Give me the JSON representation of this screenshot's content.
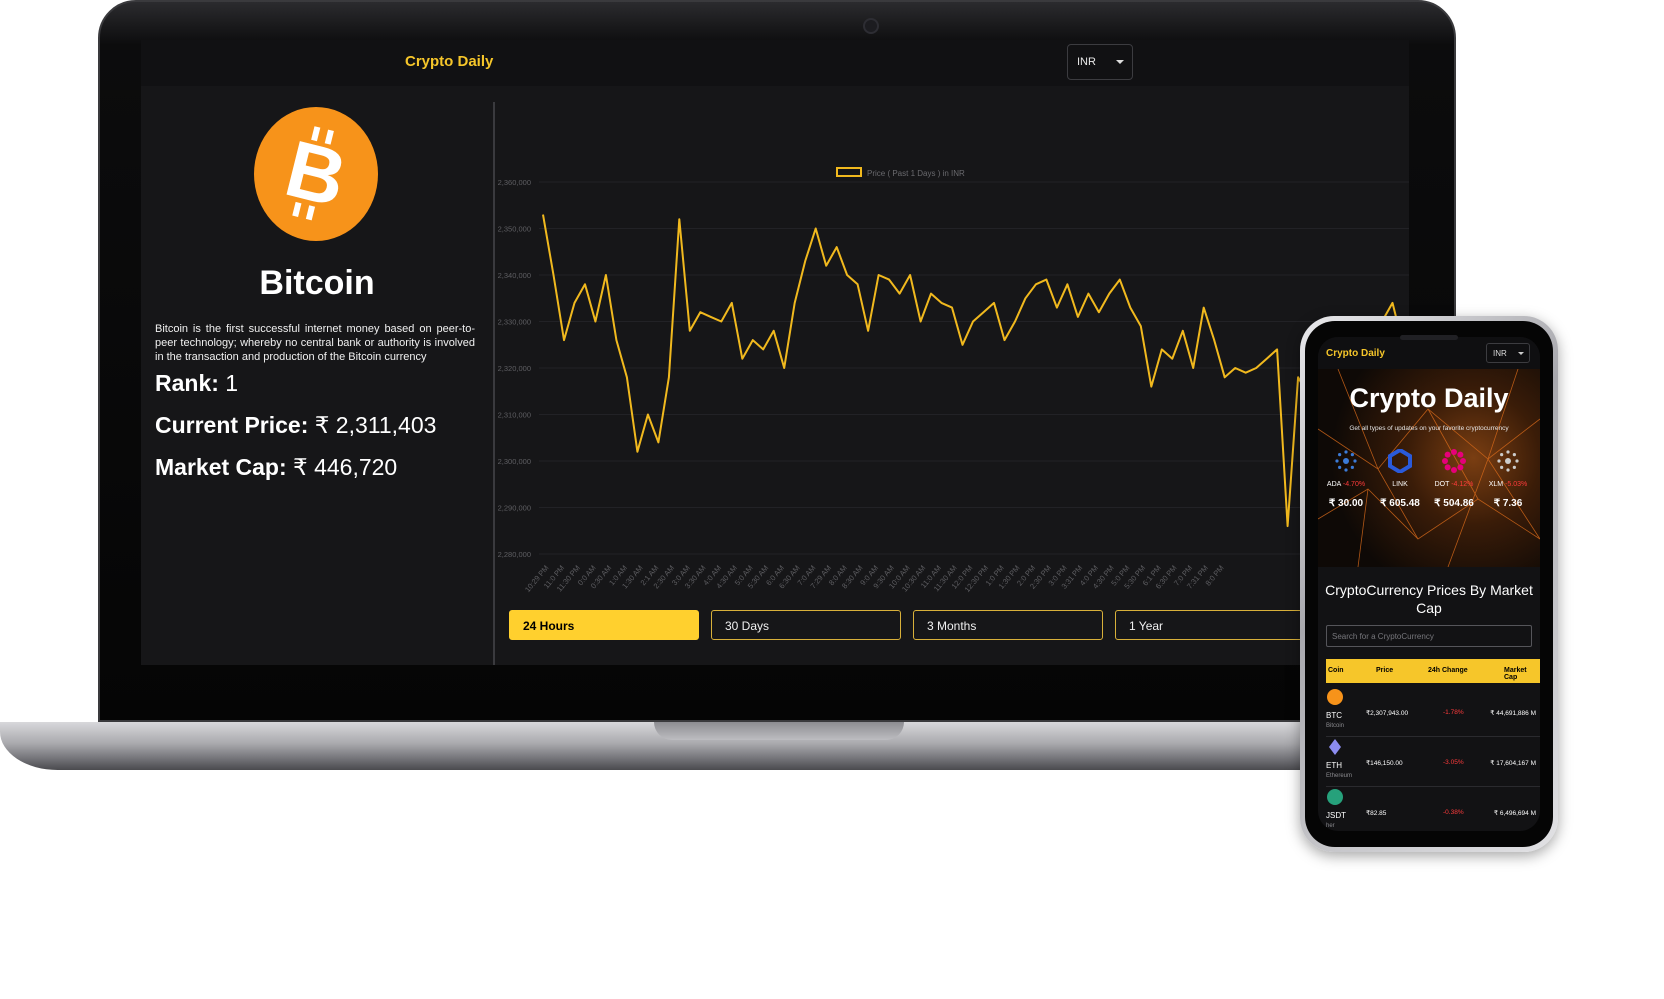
{
  "app": {
    "brand": "Crypto Daily",
    "currency": "INR"
  },
  "coin": {
    "icon": "bitcoin-icon",
    "name": "Bitcoin",
    "description": "Bitcoin is the first successful internet money based on peer-to-peer technology; whereby no central bank or authority is involved in the transaction and production of the Bitcoin currency",
    "rank_label": "Rank:",
    "rank_value": "1",
    "price_label": "Current Price:",
    "price_value": "₹ 2,311,403",
    "mcap_label": "Market Cap:",
    "mcap_value": "₹ 446,720"
  },
  "range_buttons": [
    {
      "label": "24 Hours",
      "active": true
    },
    {
      "label": "30 Days",
      "active": false
    },
    {
      "label": "3 Months",
      "active": false
    },
    {
      "label": "1 Year",
      "active": false
    }
  ],
  "colors": {
    "accent": "#ffd02e",
    "line": "#f1b91e",
    "negative": "#ff3b3b",
    "bitcoin": "#f7931a"
  },
  "chart_data": {
    "type": "line",
    "legend": "Price ( Past 1 Days ) in INR",
    "legend_position": "top",
    "ylim": [
      2280000,
      2360000
    ],
    "yticks": [
      "2,280,000",
      "2,290,000",
      "2,300,000",
      "2,310,000",
      "2,320,000",
      "2,330,000",
      "2,340,000",
      "2,350,000",
      "2,360,000"
    ],
    "xticks": [
      "10:29 PM",
      "11:0 PM",
      "11:30 PM",
      "0:0 AM",
      "0:30 AM",
      "1:0 AM",
      "1:30 AM",
      "2:1 AM",
      "2:30 AM",
      "3:0 AM",
      "3:30 AM",
      "4:0 AM",
      "4:30 AM",
      "5:0 AM",
      "5:30 AM",
      "6:0 AM",
      "6:30 AM",
      "7:0 AM",
      "7:29 AM",
      "8:0 AM",
      "8:30 AM",
      "9:0 AM",
      "9:30 AM",
      "10:0 AM",
      "10:30 AM",
      "11:0 AM",
      "11:30 AM",
      "12:0 PM",
      "12:30 PM",
      "1:0 PM",
      "1:30 PM",
      "2:0 PM",
      "2:30 PM",
      "3:0 PM",
      "3:31 PM",
      "4:0 PM",
      "4:30 PM",
      "5:0 PM",
      "5:30 PM",
      "6:1 PM",
      "6:30 PM",
      "7:0 PM",
      "7:31 PM",
      "8:0 PM"
    ],
    "grid": true,
    "series": [
      {
        "values": [
          2353000,
          2340000,
          2326000,
          2334000,
          2338000,
          2330000,
          2340000,
          2326000,
          2318000,
          2302000,
          2310000,
          2304000,
          2318000,
          2352000,
          2328000,
          2332000,
          2331000,
          2330000,
          2334000,
          2322000,
          2326000,
          2324000,
          2328000,
          2320000,
          2334000,
          2343000,
          2350000,
          2342000,
          2346000,
          2340000,
          2338000,
          2328000,
          2340000,
          2339000,
          2336000,
          2340000,
          2330000,
          2336000,
          2334000,
          2333000,
          2325000,
          2330000,
          2332000,
          2334000,
          2326000,
          2330000,
          2335000,
          2338000,
          2339000,
          2333000,
          2338000,
          2331000,
          2336000,
          2332000,
          2336000,
          2339000,
          2333000,
          2329000,
          2316000,
          2324000,
          2322000,
          2328000,
          2320000,
          2333000,
          2326000,
          2318000,
          2320000,
          2319000,
          2320000,
          2322000,
          2324000,
          2286000,
          2318000,
          2314000,
          2322000,
          2320000,
          2319000,
          2315000,
          2320000,
          2302000,
          2330000,
          2334000,
          2325000
        ]
      }
    ]
  },
  "phone": {
    "brand": "Crypto Daily",
    "currency": "INR",
    "hero_title": "Crypto Daily",
    "hero_subtitle": "Get all types of updates on your favorite cryptocurrency",
    "hero_coins": [
      {
        "symbol": "ADA",
        "change": "-4.70%",
        "price": "₹ 30.00",
        "icon": "cardano-icon",
        "color": "#3b7bd8"
      },
      {
        "symbol": "LINK",
        "change": "",
        "price": "₹ 605.48",
        "icon": "chainlink-icon",
        "color": "#2a5ada"
      },
      {
        "symbol": "DOT",
        "change": "-4.12%",
        "price": "₹ 504.86",
        "icon": "polkadot-icon",
        "color": "#e6007a"
      },
      {
        "symbol": "XLM",
        "change": "-5.03%",
        "price": "₹ 7.36",
        "icon": "stellar-icon",
        "color": "#cccccc"
      }
    ],
    "section_title": "CryptoCurrency Prices By Market Cap",
    "search_placeholder": "Search for a CryptoCurrency",
    "table_headers": [
      "Coin",
      "Price",
      "24h Change",
      "Market Cap"
    ],
    "rows": [
      {
        "ticker": "BTC",
        "name": "Bitcoin",
        "price": "₹2,307,943.00",
        "change": "-1.78%",
        "mcap": "₹ 44,691,886 M",
        "icon": "bitcoin-icon",
        "color": "#f7931a"
      },
      {
        "ticker": "ETH",
        "name": "Ethereum",
        "price": "₹146,150.00",
        "change": "-3.05%",
        "mcap": "₹ 17,604,167 M",
        "icon": "ethereum-icon",
        "color": "#8c8cf0"
      },
      {
        "ticker": "JSDT",
        "name": "her",
        "price": "₹82.85",
        "change": "-0.38%",
        "mcap": "₹ 6,496,694 M",
        "icon": "tether-icon",
        "color": "#26a17b"
      }
    ]
  }
}
